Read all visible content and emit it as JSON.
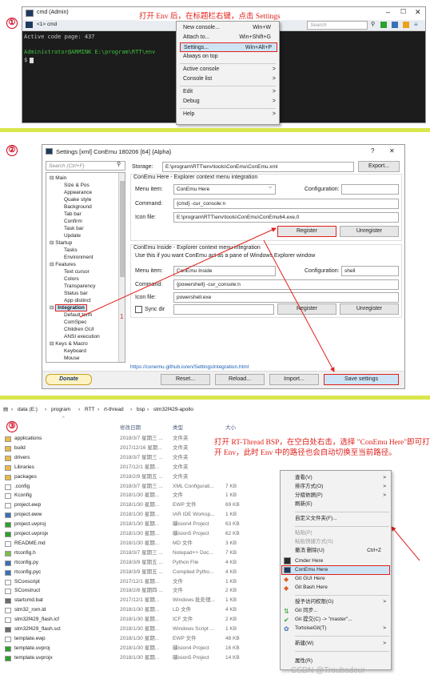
{
  "section1": {
    "number": "①",
    "window_title": "cmd (Admin)",
    "tab_label": "<1> cmd",
    "search_placeholder": "Search",
    "terminal_line1": "Active code page: 437",
    "terminal_line2": "Administrator@ARMINK E:\\program\\RTT\\env",
    "terminal_prompt": "$",
    "annotation": "打开 Env 后，在标题栏右键，点击 Settings",
    "menu": [
      {
        "label": "New console...",
        "shortcut": "Win+W"
      },
      {
        "label": "Attach to...",
        "shortcut": "Win+Shift+G"
      },
      {
        "label": "Settings...",
        "shortcut": "Win+Alt+P"
      },
      {
        "label": "Always on top",
        "shortcut": ""
      },
      {
        "label": "Active console",
        "shortcut": ">"
      },
      {
        "label": "Console list",
        "shortcut": ">"
      },
      {
        "label": "Edit",
        "shortcut": ">"
      },
      {
        "label": "Debug",
        "shortcut": ">"
      },
      {
        "label": "Help",
        "shortcut": ">"
      }
    ]
  },
  "section2": {
    "number": "②",
    "window_title": "Settings [xml] ConEmu 180206 [64] {Alpha}",
    "help_glyph": "?",
    "close_glyph": "✕",
    "search_placeholder": "Search (Ctrl+F)",
    "storage_label": "Storage:",
    "storage_value": "E:\\program\\RTT\\env\\tools\\ConEmu\\ConEmu.xml",
    "export_label": "Export...",
    "here_group": "ConEmu Here - Explorer context menu integration",
    "menu_item_label": "Menu item:",
    "menu_item_value": "ConEmu Here",
    "configuration_label": "Configuration:",
    "command_label": "Command:",
    "command_value": "{cmd} -cur_console:n",
    "icon_label": "Icon file:",
    "icon_value": "E:\\program\\RTT\\env\\tools\\ConEmu\\ConEmu64.exe,0",
    "register_label": "Register",
    "unregister_label": "Unregister",
    "inside_group": "ConEmu Inside - Explorer context menu integration",
    "inside_note": "Use this if you want ConEmu act as a pane of Windows Explorer window",
    "inside_menu_value": "ConEmu Inside",
    "inside_config_value": "shell",
    "inside_command_value": "{powershell} -cur_console:n",
    "inside_icon_value": "powershell.exe",
    "sync_dir_label": "Sync dir",
    "link": "https://conemu.github.io/en/SettingsIntegration.html",
    "donate_label": "Donate",
    "reset_label": "Reset...",
    "reload_label": "Reload...",
    "import_label": "Import...",
    "save_label": "Save settings",
    "arrow_number": "1",
    "tree": [
      {
        "label": "Main",
        "level": 0
      },
      {
        "label": "Size & Pos",
        "level": 1
      },
      {
        "label": "Appearance",
        "level": 1
      },
      {
        "label": "Quake style",
        "level": 1
      },
      {
        "label": "Background",
        "level": 1
      },
      {
        "label": "Tab bar",
        "level": 1
      },
      {
        "label": "Confirm",
        "level": 1
      },
      {
        "label": "Task bar",
        "level": 1
      },
      {
        "label": "Update",
        "level": 1
      },
      {
        "label": "Startup",
        "level": 0
      },
      {
        "label": "Tasks",
        "level": 1
      },
      {
        "label": "Environment",
        "level": 1
      },
      {
        "label": "Features",
        "level": 0
      },
      {
        "label": "Text cursor",
        "level": 1
      },
      {
        "label": "Colors",
        "level": 1
      },
      {
        "label": "Transparency",
        "level": 1
      },
      {
        "label": "Status bar",
        "level": 1
      },
      {
        "label": "App distinct",
        "level": 1
      },
      {
        "label": "Integration",
        "level": 0
      },
      {
        "label": "Default term",
        "level": 1
      },
      {
        "label": "ComSpec",
        "level": 1
      },
      {
        "label": "Children GUI",
        "level": 1
      },
      {
        "label": "ANSI execution",
        "level": 1
      },
      {
        "label": "Keys & Macro",
        "level": 0
      },
      {
        "label": "Keyboard",
        "level": 1
      },
      {
        "label": "Mouse",
        "level": 1
      }
    ]
  },
  "section3": {
    "number": "③",
    "breadcrumb": [
      "data (E:)",
      "program",
      "RTT",
      "rt-thread",
      "bsp",
      "stm32f429-apollo"
    ],
    "col_date": "修改日期",
    "col_type": "类型",
    "col_size": "大小",
    "annotation": "打开 RT-Thread BSP，在空白处右击，选择 \"ConEmu Here\"即可打开 Env，此时 Env 中的路径也会自动切换至当前路径。",
    "files": [
      {
        "name": "applications",
        "date": "2018/3/7 星期三 ...",
        "type": "文件夹",
        "size": "",
        "icon": "folder"
      },
      {
        "name": "build",
        "date": "2017/12/16 星期...",
        "type": "文件夹",
        "size": "",
        "icon": "folder"
      },
      {
        "name": "drivers",
        "date": "2018/3/7 星期三 ...",
        "type": "文件夹",
        "size": "",
        "icon": "folder"
      },
      {
        "name": "Libraries",
        "date": "2017/12/1 星期...",
        "type": "文件夹",
        "size": "",
        "icon": "folder"
      },
      {
        "name": "packages",
        "date": "2018/2/9 星期五 ...",
        "type": "文件夹",
        "size": "",
        "icon": "folder"
      },
      {
        "name": ".config",
        "date": "2018/3/7 星期三 ...",
        "type": "XML Configurati...",
        "size": "7 KB",
        "icon": "file"
      },
      {
        "name": "Kconfig",
        "date": "2018/1/30 星期...",
        "type": "文件",
        "size": "1 KB",
        "icon": "file"
      },
      {
        "name": "project.ewp",
        "date": "2018/1/30 星期...",
        "type": "EWP 文件",
        "size": "69 KB",
        "icon": "file"
      },
      {
        "name": "project.eww",
        "date": "2018/1/30 星期...",
        "type": "IAR IDE Worksp...",
        "size": "1 KB",
        "icon": "iar"
      },
      {
        "name": "project.uvproj",
        "date": "2018/1/30 星期...",
        "type": "礦ision4 Project",
        "size": "63 KB",
        "icon": "keil"
      },
      {
        "name": "project.uvprojx",
        "date": "2018/1/30 星期...",
        "type": "礦ision5 Project",
        "size": "62 KB",
        "icon": "keil"
      },
      {
        "name": "README.md",
        "date": "2018/1/30 星期...",
        "type": "MD 文件",
        "size": "3 KB",
        "icon": "file"
      },
      {
        "name": "rtconfig.h",
        "date": "2018/3/7 星期三 ...",
        "type": "Notepad++ Doc...",
        "size": "7 KB",
        "icon": "npp"
      },
      {
        "name": "rtconfig.py",
        "date": "2018/3/9 星期五 ...",
        "type": "Python File",
        "size": "4 KB",
        "icon": "py"
      },
      {
        "name": "rtconfig.pyc",
        "date": "2018/3/9 星期五 ...",
        "type": "Compiled Pytho...",
        "size": "4 KB",
        "icon": "py"
      },
      {
        "name": "SConscript",
        "date": "2017/12/1 星期...",
        "type": "文件",
        "size": "1 KB",
        "icon": "file"
      },
      {
        "name": "SConstruct",
        "date": "2018/2/8 星期四 ...",
        "type": "文件",
        "size": "2 KB",
        "icon": "file"
      },
      {
        "name": "startcmd.bat",
        "date": "2017/12/1 星期...",
        "type": "Windows 批处理...",
        "size": "1 KB",
        "icon": "bat"
      },
      {
        "name": "stm32_rom.ld",
        "date": "2018/1/30 星期...",
        "type": "LD 文件",
        "size": "4 KB",
        "icon": "file"
      },
      {
        "name": "stm32f429_flash.icf",
        "date": "2018/1/30 星期...",
        "type": "ICF 文件",
        "size": "2 KB",
        "icon": "file"
      },
      {
        "name": "stm32f429_flash.sct",
        "date": "2018/1/30 星期...",
        "type": "Windows Script ...",
        "size": "1 KB",
        "icon": "bat"
      },
      {
        "name": "template.ewp",
        "date": "2018/1/30 星期...",
        "type": "EWP 文件",
        "size": "48 KB",
        "icon": "file"
      },
      {
        "name": "template.uvproj",
        "date": "2018/1/30 星期...",
        "type": "礦ision4 Project",
        "size": "16 KB",
        "icon": "keil"
      },
      {
        "name": "template.uvprojx",
        "date": "2018/1/30 星期...",
        "type": "礦ision5 Project",
        "size": "14 KB",
        "icon": "keil"
      }
    ],
    "menu": [
      {
        "label": "查看(V)",
        "extra": ">"
      },
      {
        "label": "排序方式(O)",
        "extra": ">"
      },
      {
        "label": "分组依据(P)",
        "extra": ">"
      },
      {
        "label": "刷新(E)",
        "extra": ""
      },
      {
        "label": "自定义文件夹(F)...",
        "extra": ""
      },
      {
        "label": "粘贴(P)",
        "extra": ""
      },
      {
        "label": "粘贴快捷方式(S)",
        "extra": ""
      },
      {
        "label": "撤消 删除(U)",
        "extra": "Ctrl+Z"
      },
      {
        "label": "Cmder Here",
        "extra": ""
      },
      {
        "label": "ConEmu Here",
        "extra": ""
      },
      {
        "label": "Git GUI Here",
        "extra": ""
      },
      {
        "label": "Git Bash Here",
        "extra": ""
      },
      {
        "label": "授予访问权限(G)",
        "extra": ">"
      },
      {
        "label": "Git 同步...",
        "extra": ""
      },
      {
        "label": "Git 提交(C) -> \"master\"...",
        "extra": ""
      },
      {
        "label": "TortoiseGit(T)",
        "extra": ">"
      },
      {
        "label": "新建(W)",
        "extra": ">"
      },
      {
        "label": "属性(R)",
        "extra": ""
      }
    ],
    "watermark": "CSDN @Troubadour~"
  }
}
